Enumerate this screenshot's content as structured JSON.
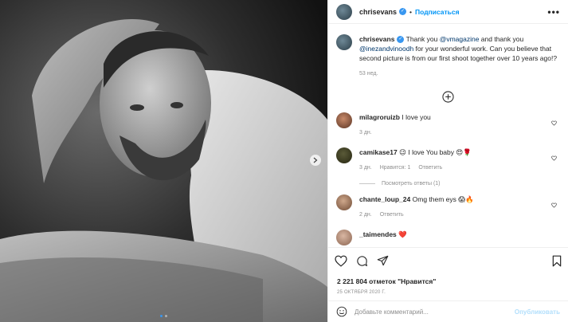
{
  "header": {
    "username": "chrisevans",
    "separator": "•",
    "follow_label": "Подписаться",
    "more_label": "•••"
  },
  "caption": {
    "username": "chrisevans",
    "text_before": "Thank you ",
    "mention1": "@vmagazine",
    "text_middle": " and thank you ",
    "mention2": "@inezandvinoodh",
    "text_after": " for your wonderful work. Can you believe that second picture is from our first shoot together over 10 years ago!?",
    "time": "53 нед."
  },
  "comments": [
    {
      "username": "milagroruizb",
      "text": "I love you",
      "time": "3 дн.",
      "likes": "",
      "reply": ""
    },
    {
      "username": "camikase17",
      "text": "😉 I love You baby 😍🌹",
      "time": "3 дн.",
      "likes": "Нравится: 1",
      "reply": "Ответить"
    },
    {
      "username": "chante_loup_24",
      "text": "Omg them eys 😱🔥",
      "time": "2 дн.",
      "likes": "",
      "reply": "Ответить"
    },
    {
      "username": "_taimendes",
      "text": "❤️",
      "time": "",
      "likes": "",
      "reply": ""
    }
  ],
  "view_replies": "Посмотреть ответы (1)",
  "reply_label": "Ответить",
  "likes_count": "2 221 804 отметок \"Нравится\"",
  "post_date": "25 ОКТЯБРЯ 2020 Г.",
  "comment_input": {
    "placeholder": "Добавьте комментарий...",
    "value": ""
  },
  "publish_label": "Опубликовать",
  "carousel": {
    "total": 2,
    "current": 1
  },
  "colors": {
    "accent": "#0095f6",
    "verified": "#3897f0",
    "muted": "#8e8e8e",
    "publish_disabled": "#b2dffc"
  }
}
